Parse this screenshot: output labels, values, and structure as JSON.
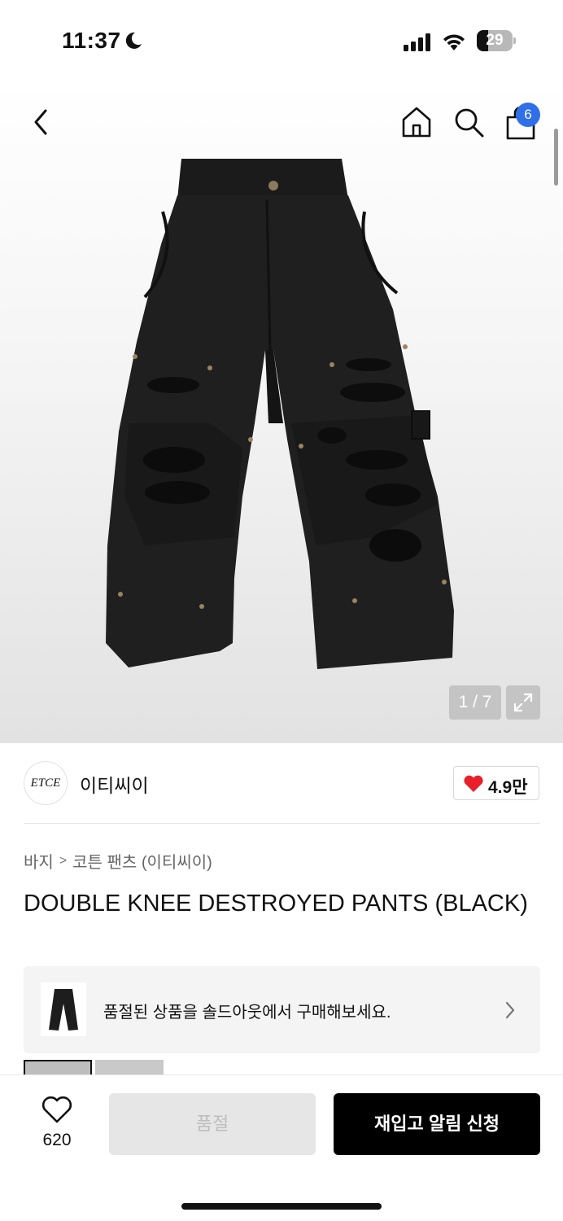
{
  "status_bar": {
    "time": "11:37",
    "battery": "29"
  },
  "top_nav": {
    "cart_count": "6",
    "icons": [
      "back-icon",
      "home-icon",
      "search-icon",
      "cart-icon"
    ]
  },
  "gallery": {
    "counter": "1 / 7",
    "current_index": 1,
    "total": 7
  },
  "brand": {
    "logo_text": "ETCE",
    "name": "이티씨이",
    "likes": "4.9만",
    "like_color": "#e8202a"
  },
  "breadcrumb": {
    "items": [
      "바지",
      "코튼 팬츠 (이티씨이)"
    ]
  },
  "product": {
    "title": "DOUBLE KNEE DESTROYED PANTS (BLACK)"
  },
  "soldout_banner": {
    "text": "품절된 상품을 솔드아웃에서 구매해보세요."
  },
  "bottom_bar": {
    "wish_count": "620",
    "soldout_label": "품절",
    "restock_label": "재입고 알림 신청"
  }
}
